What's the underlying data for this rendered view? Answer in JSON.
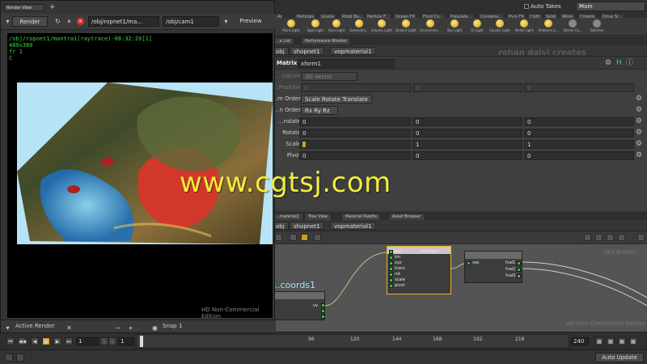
{
  "top_bar": {
    "auto_takes": "Auto Takes",
    "main_select": "Main"
  },
  "shelf_tabs": [
    "Particles",
    "Grains",
    "Rigid Bo...",
    "Particle F...",
    "Ocean FX",
    "Fluid Co...",
    "Populate...",
    "Containe...",
    "Pyro FX",
    "Cloth",
    "Solid",
    "Wires",
    "Crowds",
    "Drive Si..."
  ],
  "light_items": [
    "Point Light",
    "Spot Light",
    "Area Light",
    "Geometry...",
    "Volume Light",
    "Distant Light",
    "Environme...",
    "Sky Light",
    "GI Light",
    "Caustic Light",
    "Portal Light",
    "Ambient Li...",
    "Stereo Ca...",
    "Switcher"
  ],
  "param_tabs": [
    "...e List",
    "Performance Monitor"
  ],
  "param_path": {
    "obj": "obj",
    "shopnet": "shopnet1",
    "vopmaterial": "vopmaterial1",
    "creator": "rohan dalvi creates"
  },
  "matrix": {
    "label": "Matrix",
    "name": "xform1"
  },
  "params": {
    "signature": {
      "label": "...nature",
      "value": "3D Vector"
    },
    "position": {
      "label": "...Position",
      "values": [
        "0",
        "0",
        "0"
      ]
    },
    "xform_order": {
      "label": "...m Order",
      "value": "Scale Rotate Translate"
    },
    "rot_order": {
      "label": "...n Order",
      "value": "Rx Ry Rz"
    },
    "translate": {
      "label": "...nslate",
      "values": [
        "0",
        "0",
        "0"
      ]
    },
    "rotate": {
      "label": "Rotate",
      "values": [
        "0",
        "0",
        "0"
      ]
    },
    "scale": {
      "label": "Scale",
      "values": [
        "",
        "1",
        "1"
      ]
    },
    "pivot": {
      "label": "Pivot",
      "values": [
        "0",
        "0",
        "0"
      ]
    }
  },
  "net_tabs": [
    "...material2",
    "Tree View",
    "Material Palette",
    "Asset Browser"
  ],
  "net_path": {
    "obj": "obj",
    "shopnet": "shopnet1",
    "vopmaterial": "vopmaterial1"
  },
  "nodes": {
    "coords_label": "...coords1",
    "xform_inputs": [
      "pos",
      "trn",
      "xyz",
      "trans",
      "rot",
      "scale",
      "pivot"
    ],
    "xform_output": "xformpos",
    "vec_in": "vec",
    "vec_outputs": [
      "fval1",
      "fval2",
      "fval3"
    ],
    "uv_label": "uv"
  },
  "hd_watermark": "HD Non-Commercial Edition",
  "vex_label": "VEX Builder",
  "timeline": {
    "frame": "1",
    "start": "1",
    "ticks": [
      "96",
      "120",
      "144",
      "168",
      "192",
      "216"
    ],
    "end_frame": "240",
    "auto_update": "Auto Update"
  },
  "render_view": {
    "tab": "Render View",
    "render_button": "Render",
    "rop_path": "/obj/ropnet1/ma...",
    "camera": "/obj/cam1",
    "preview": "Preview",
    "info_lines": [
      "/obj/ropnet1/mantra1(raytrace)-08:32:20[1]",
      "480x360",
      "fr 1",
      "C"
    ],
    "hd_watermark": "HD Non-Commercial Edition",
    "active_render": "Active Render",
    "snap": "Snap",
    "snap_value": "1"
  },
  "site_watermark": "www.cgtsj.com",
  "colors": {
    "accent_green": "#39d839",
    "watermark_yellow": "#f2ee3a",
    "node_port": "#3bbf3b",
    "selected_node": "#f0b020"
  }
}
